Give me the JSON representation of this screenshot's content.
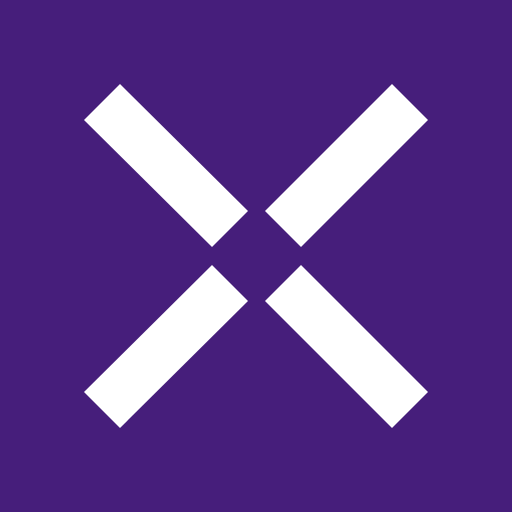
{
  "logo": {
    "name": "x-mark-logo",
    "icon": "x-mark-icon",
    "background_color": "#461e7b",
    "mark_color": "#ffffff"
  }
}
